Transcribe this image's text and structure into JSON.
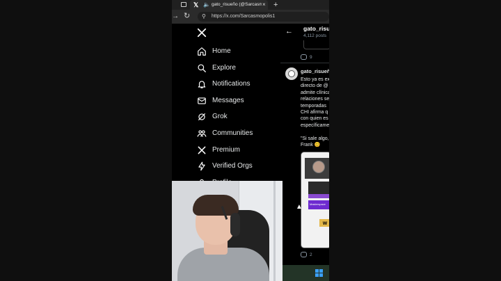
{
  "browser": {
    "tab_title": "gato_risueño (@Sarcasmopolis1)",
    "tab_close": "×",
    "new_tab": "+",
    "url": "https://x.com/Sarcasmopolis1"
  },
  "sidebar": {
    "items": [
      {
        "label": "Home",
        "icon": "home-icon"
      },
      {
        "label": "Explore",
        "icon": "search-icon"
      },
      {
        "label": "Notifications",
        "icon": "bell-icon"
      },
      {
        "label": "Messages",
        "icon": "mail-icon"
      },
      {
        "label": "Grok",
        "icon": "grok-icon"
      },
      {
        "label": "Communities",
        "icon": "people-icon"
      },
      {
        "label": "Premium",
        "icon": "x-logo-icon"
      },
      {
        "label": "Verified Orgs",
        "icon": "lightning-icon"
      },
      {
        "label": "Profile",
        "icon": "person-icon"
      }
    ]
  },
  "timeline": {
    "header_name": "gato_risueñ",
    "header_posts": "4,112 posts",
    "prev_reply_count": "9",
    "post": {
      "author": "gato_risueñ",
      "lines": [
        "Esto ya es ex",
        "directo de @",
        "admite clínica",
        "relaciones se",
        "temporadas",
        "CHI afirma q",
        "con quien es",
        "específicame",
        "",
        "\"Si sale algo,",
        "Frank 😊"
      ],
      "quote_promo": "Masterspace",
      "reply_count": "2"
    }
  },
  "colors": {
    "accent": "#1d9bf0",
    "background": "#000000",
    "text": "#e7e9ea",
    "muted": "#8b98a5",
    "taskbar": "#233427"
  }
}
